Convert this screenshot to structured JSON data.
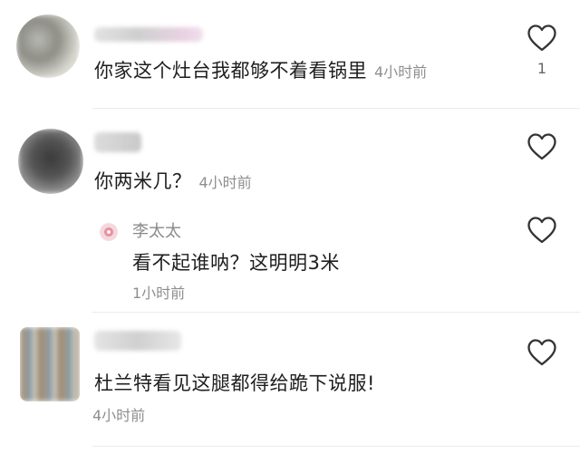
{
  "comments": [
    {
      "text": "你家这个灶台我都够不着看锅里",
      "time": "4小时前",
      "likes": "1",
      "icon": "heart-outline-icon"
    },
    {
      "text": "你两米几？",
      "time": "4小时前",
      "icon": "heart-outline-icon",
      "reply": {
        "name": "李太太",
        "text": "看不起谁呐？这明明3米",
        "time": "1小时前",
        "icon": "heart-outline-icon"
      }
    },
    {
      "text": "杜兰特看见这腿都得给跪下说服!",
      "time": "4小时前",
      "icon": "heart-outline-icon"
    }
  ],
  "colors": {
    "text": "#1e1e1e",
    "muted": "#8e8e8e",
    "divider": "#ececec",
    "icon": "#333333"
  }
}
